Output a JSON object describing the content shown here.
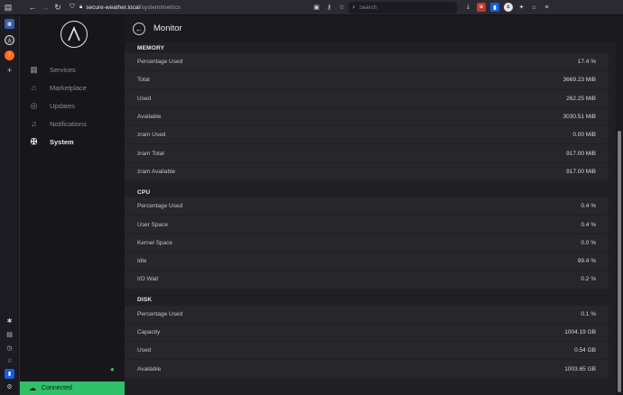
{
  "browser": {
    "url_host": "secure-weather.local",
    "url_path": "/system/metrics",
    "search_placeholder": "Search"
  },
  "nav": {
    "items": [
      {
        "label": "Services",
        "icon": "grid-icon"
      },
      {
        "label": "Marketplace",
        "icon": "store-icon"
      },
      {
        "label": "Updates",
        "icon": "globe-icon"
      },
      {
        "label": "Notifications",
        "icon": "bell-icon"
      },
      {
        "label": "System",
        "icon": "tools-icon"
      }
    ],
    "status": "Connected"
  },
  "header": {
    "title": "Monitor"
  },
  "sections": [
    {
      "title": "MEMORY",
      "rows": [
        {
          "label": "Percentage Used",
          "value": "17.4 %"
        },
        {
          "label": "Total",
          "value": "3669.23 MiB"
        },
        {
          "label": "Used",
          "value": "262.25 MiB"
        },
        {
          "label": "Available",
          "value": "3030.51 MiB"
        },
        {
          "label": "zram Used",
          "value": "0.00 MiB"
        },
        {
          "label": "zram Total",
          "value": "917.00 MiB"
        },
        {
          "label": "zram Available",
          "value": "917.00 MiB"
        }
      ]
    },
    {
      "title": "CPU",
      "rows": [
        {
          "label": "Percentage Used",
          "value": "0.4 %"
        },
        {
          "label": "User Space",
          "value": "0.4 %"
        },
        {
          "label": "Kernel Space",
          "value": "0.0 %"
        },
        {
          "label": "Idle",
          "value": "99.4 %"
        },
        {
          "label": "I/O Wait",
          "value": "0.2 %"
        }
      ]
    },
    {
      "title": "DISK",
      "rows": [
        {
          "label": "Percentage Used",
          "value": "0.1 %"
        },
        {
          "label": "Capacity",
          "value": "1004.19 GB"
        },
        {
          "label": "Used",
          "value": "0.54 GB"
        },
        {
          "label": "Available",
          "value": "1003.65 GB"
        }
      ]
    }
  ],
  "colors": {
    "accent": "#2fc06a",
    "background": "#1f1f24",
    "row": "#26262b"
  }
}
